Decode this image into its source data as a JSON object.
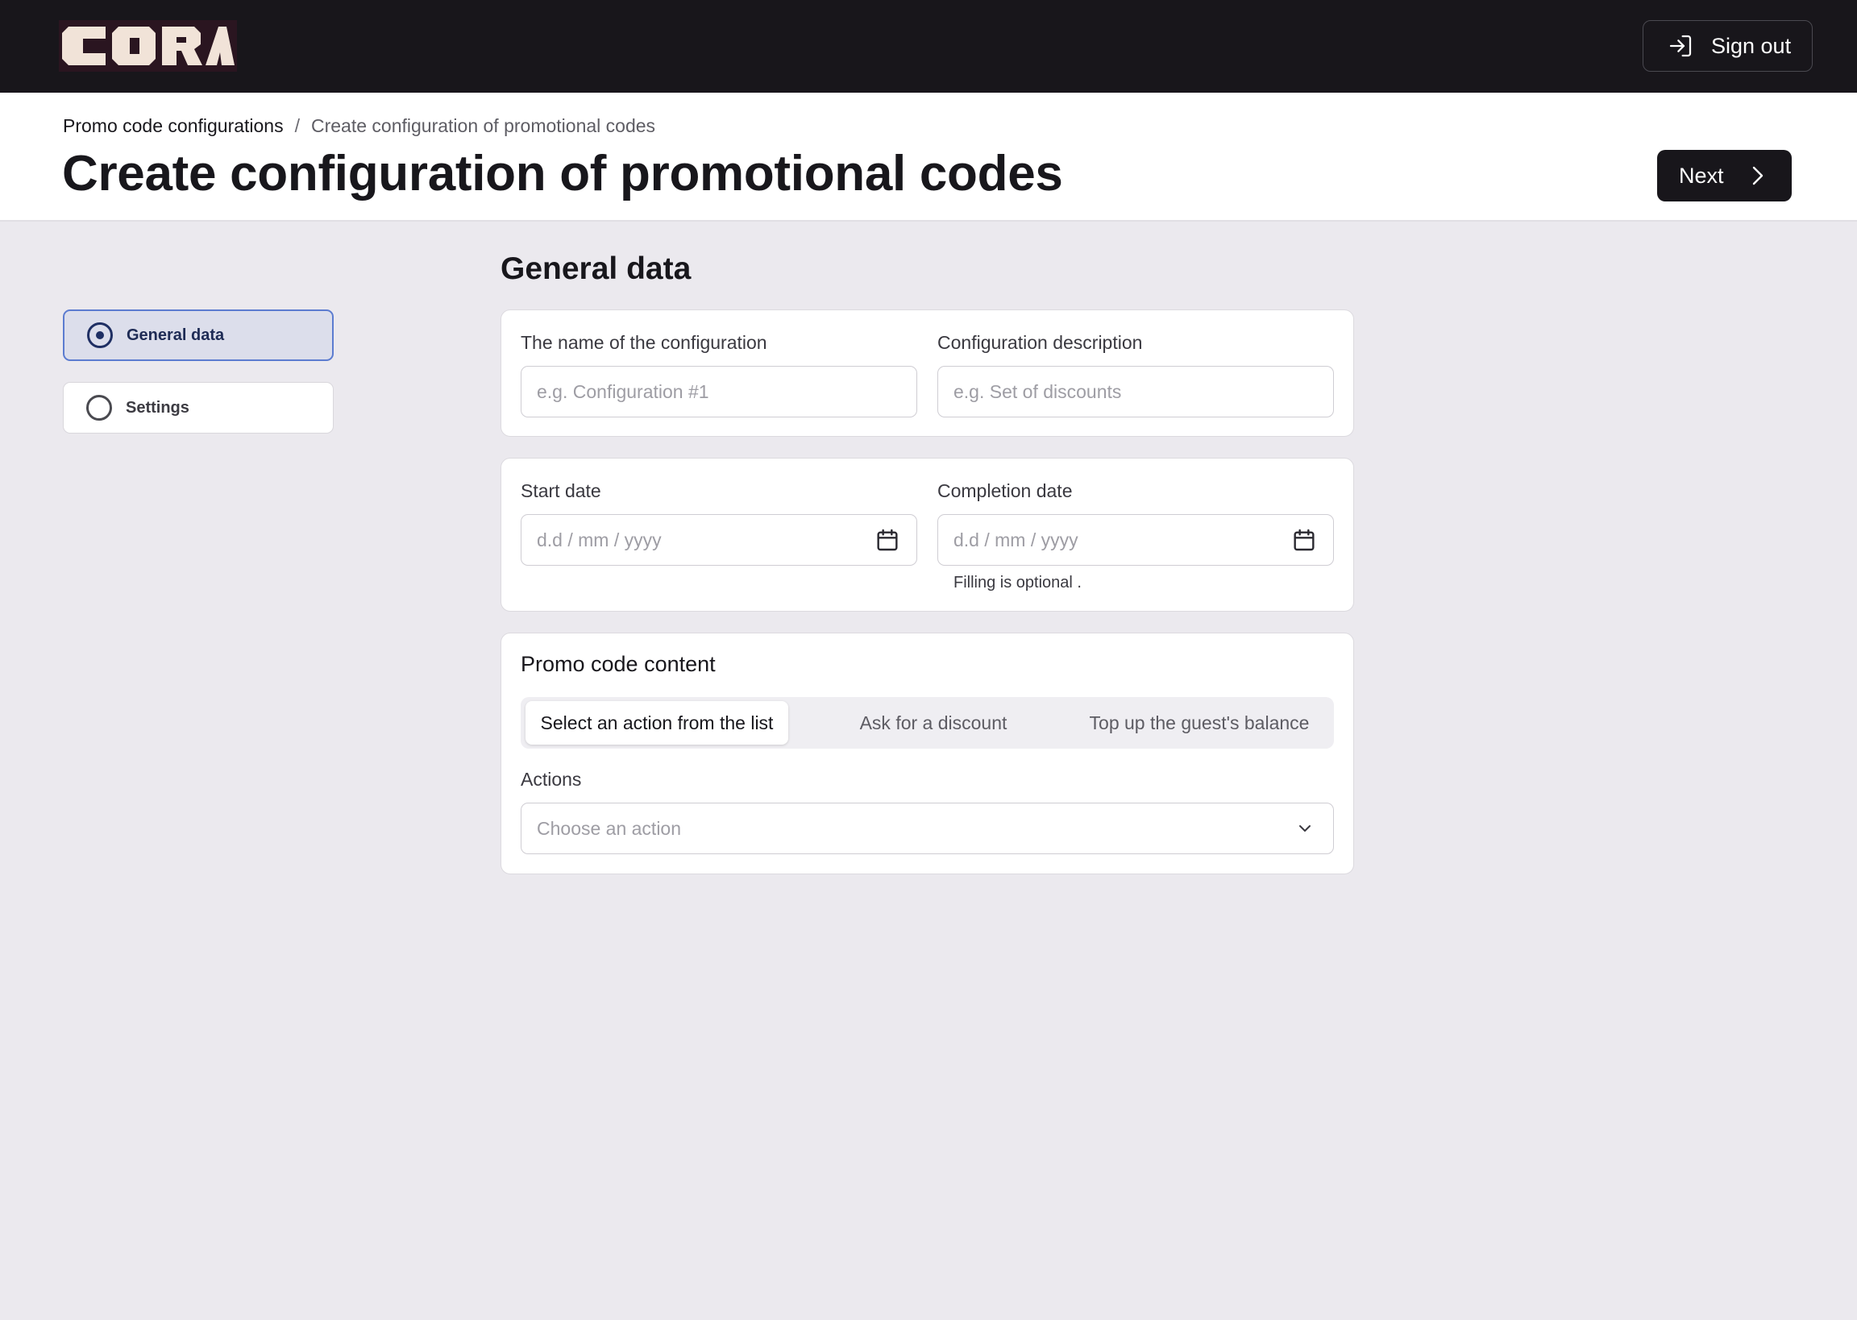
{
  "app": {
    "logo_text": "CORA",
    "sign_out_label": "Sign out"
  },
  "breadcrumb": {
    "parent": "Promo code configurations",
    "separator": "/",
    "current": "Create configuration of promotional codes"
  },
  "page": {
    "title": "Create configuration of promotional codes",
    "next_label": "Next"
  },
  "steps": [
    {
      "label": "General data",
      "active": true
    },
    {
      "label": "Settings",
      "active": false
    }
  ],
  "main": {
    "section_title": "General data",
    "config_name": {
      "label": "The name of the configuration",
      "placeholder": "e.g. Configuration #1",
      "value": ""
    },
    "config_description": {
      "label": "Configuration description",
      "placeholder": "e.g. Set of discounts",
      "value": ""
    },
    "start_date": {
      "label": "Start date",
      "placeholder": "d.d / mm / yyyy"
    },
    "completion_date": {
      "label": "Completion date",
      "placeholder": "d.d / mm / yyyy",
      "hint": "Filling is optional ."
    },
    "promo_content": {
      "heading": "Promo code content",
      "tabs": [
        {
          "label": "Select an action from the list",
          "selected": true
        },
        {
          "label": "Ask for a discount",
          "selected": false
        },
        {
          "label": "Top up the guest's balance",
          "selected": false
        }
      ],
      "actions_label": "Actions",
      "actions_placeholder": "Choose an action"
    }
  },
  "icons": {
    "sign_out": "sign-in-arrow-icon",
    "next": "chevron-right-icon",
    "calendar": "calendar-icon",
    "dropdown": "chevron-down-icon"
  },
  "colors": {
    "topbar": "#18161b",
    "background": "#ebe9ee",
    "active_step_bg": "#dcdeeb",
    "active_step_border": "#5c7cd0",
    "logo_text": "#f1e3d8"
  }
}
